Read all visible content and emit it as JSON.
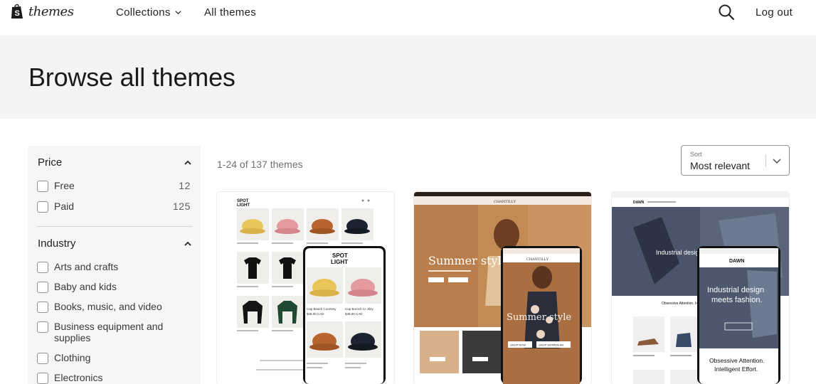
{
  "nav": {
    "logo_text": "themes",
    "collections": "Collections",
    "all_themes": "All themes",
    "logout": "Log out"
  },
  "hero": {
    "title": "Browse all themes"
  },
  "filters": {
    "price": {
      "title": "Price",
      "options": [
        {
          "label": "Free",
          "count": "12"
        },
        {
          "label": "Paid",
          "count": "125"
        }
      ]
    },
    "industry": {
      "title": "Industry",
      "options": [
        {
          "label": "Arts and crafts"
        },
        {
          "label": "Baby and kids"
        },
        {
          "label": "Books, music, and video"
        },
        {
          "label": "Business equipment and supplies"
        },
        {
          "label": "Clothing"
        },
        {
          "label": "Electronics"
        }
      ]
    }
  },
  "results": {
    "count_text": "1-24 of 137 themes"
  },
  "sort": {
    "label": "Sort",
    "value": "Most relevant"
  },
  "themes": [
    {
      "logo": "SPOT LIGHT",
      "products": [
        "Cap Beach Courtesy",
        "Cap Borsch Cr Jiley",
        "$48.00 CAD",
        "$48.00 CAD"
      ]
    },
    {
      "brand": "CHANTILLY",
      "headline": "Summer style",
      "button_shop": "SHOP NOW",
      "button_tab": "SHOP SWIMWEAR"
    },
    {
      "brand": "DAWN",
      "headline": "Industrial design meets fashion.",
      "subline": "Obsessive Attention. Intelligent Effort.",
      "mobile_headline": "Industrial design meets fashion.",
      "mobile_subline": "Obsessive Attention. Intelligent Effort."
    }
  ],
  "colors": {
    "hero_bg": "#f4f4f4",
    "sidebar_bg": "#f6f6f7",
    "text": "#202223"
  }
}
